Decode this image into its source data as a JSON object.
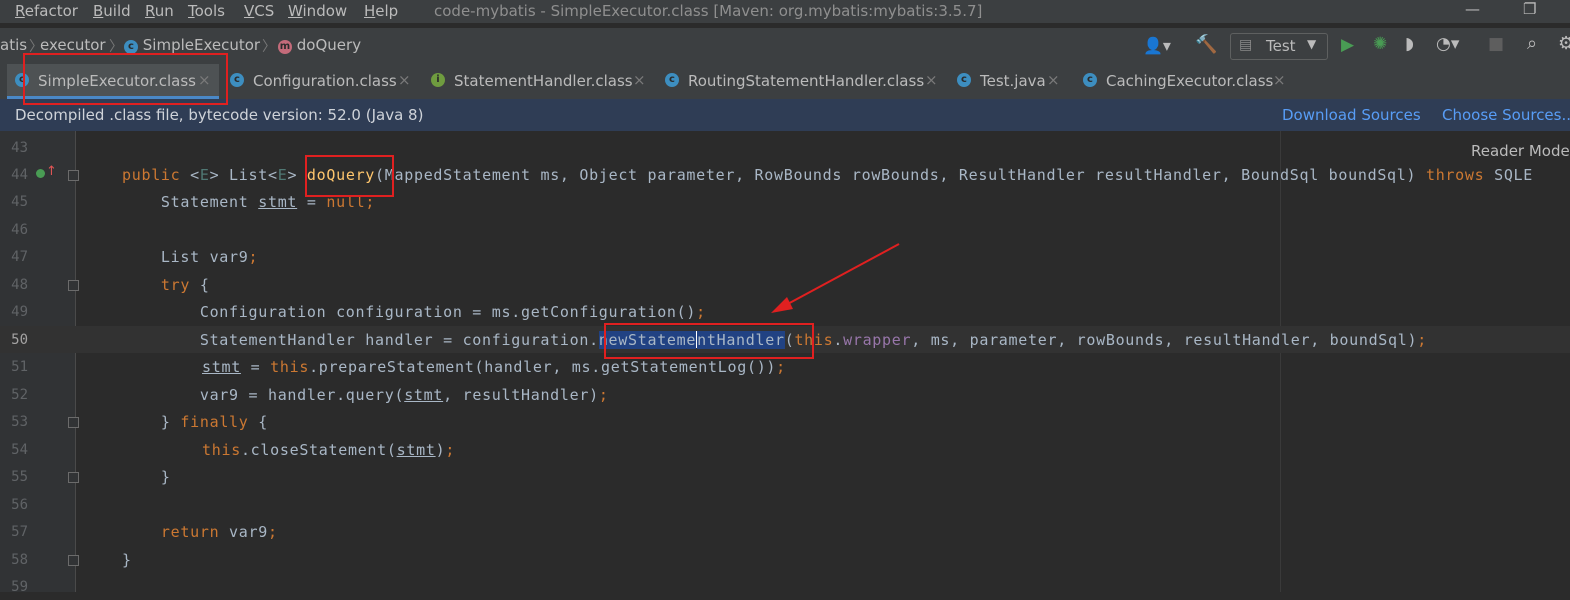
{
  "menu": {
    "items": [
      {
        "label": "Refactor",
        "ul": "R",
        "rest": "efactor"
      },
      {
        "label": "Build",
        "ul": "B",
        "rest": "uild"
      },
      {
        "label": "Run",
        "ul": "R",
        "rest": "un"
      },
      {
        "label": "Tools",
        "ul": "T",
        "rest": "ools"
      },
      {
        "label": "VCS",
        "ul": "V",
        "rest": "CS"
      },
      {
        "label": "Window",
        "ul": "W",
        "rest": "indow"
      },
      {
        "label": "Help",
        "ul": "H",
        "rest": "elp"
      }
    ]
  },
  "window_title": "code-mybatis - SimpleExecutor.class [Maven: org.mybatis:mybatis:3.5.7]",
  "breadcrumb": {
    "part0": "atis",
    "part1": "executor",
    "part2": "SimpleExecutor",
    "part3": "doQuery",
    "icon_c": "c",
    "icon_m": "m"
  },
  "run_config": "Test",
  "tabs": [
    {
      "label": "SimpleExecutor.class",
      "icon": "c"
    },
    {
      "label": "Configuration.class",
      "icon": "c"
    },
    {
      "label": "StatementHandler.class",
      "icon": "i"
    },
    {
      "label": "RoutingStatementHandler.class",
      "icon": "c"
    },
    {
      "label": "Test.java",
      "icon": "c"
    },
    {
      "label": "CachingExecutor.class",
      "icon": "c"
    }
  ],
  "tab_close": "×",
  "banner": {
    "message": "Decompiled .class file, bytecode version: 52.0 (Java 8)",
    "download": "Download Sources",
    "choose": "Choose Sources..."
  },
  "reader_mode": "Reader Mode",
  "line_numbers": [
    "43",
    "44",
    "45",
    "46",
    "47",
    "48",
    "49",
    "50",
    "51",
    "52",
    "53",
    "54",
    "55",
    "56",
    "57",
    "58",
    "59"
  ],
  "code": {
    "l44": {
      "public": "public ",
      "lt": "<",
      "E": "E",
      "gt": "> List<",
      "E2": "E",
      "gt2": "> ",
      "name": "doQuery",
      "params": "(MappedStatement ms, Object parameter, RowBounds rowBounds, ResultHandler resultHandler, BoundSql boundSql) ",
      "throws": "throws",
      "rest": " SQLE"
    },
    "l45": {
      "a": "    Statement ",
      "stmt": "stmt",
      "b": " = ",
      "null": "null",
      "c": ";"
    },
    "l47": {
      "a": "    List var9",
      "c": ";"
    },
    "l48": {
      "try": "    try",
      "b": " {"
    },
    "l49": {
      "a": "        Configuration configuration = ms.getConfiguration()",
      "c": ";"
    },
    "l50": {
      "a": "        StatementHandler handler = configuration",
      "dot": ".",
      "sel1": "newStateme",
      "sel2": "ntHandler",
      "paren": "(",
      "this": "this",
      "dot2": ".",
      "wrapper": "wrapper",
      "rest": ", ms, parameter, rowBounds, resultHandler, boundSql)",
      "c": ";"
    },
    "l51": {
      "stmt": "stmt",
      "a": " = ",
      "this": "this",
      "b": ".prepareStatement(handler, ms.getStatementLog())",
      "c": ";"
    },
    "l52": {
      "a": "        var9 = handler.query(",
      "stmt": "stmt",
      "b": ", resultHandler)",
      "c": ";"
    },
    "l53": {
      "a": "    } ",
      "finally": "finally",
      "b": " {"
    },
    "l54": {
      "this": "this",
      "b": ".closeStatement(",
      "stmt": "stmt",
      "c": ")",
      "d": ";"
    },
    "l55": {
      "a": "    }"
    },
    "l57": {
      "return": "    return",
      "b": " var9",
      "c": ";"
    },
    "l58": {
      "a": "}"
    }
  }
}
